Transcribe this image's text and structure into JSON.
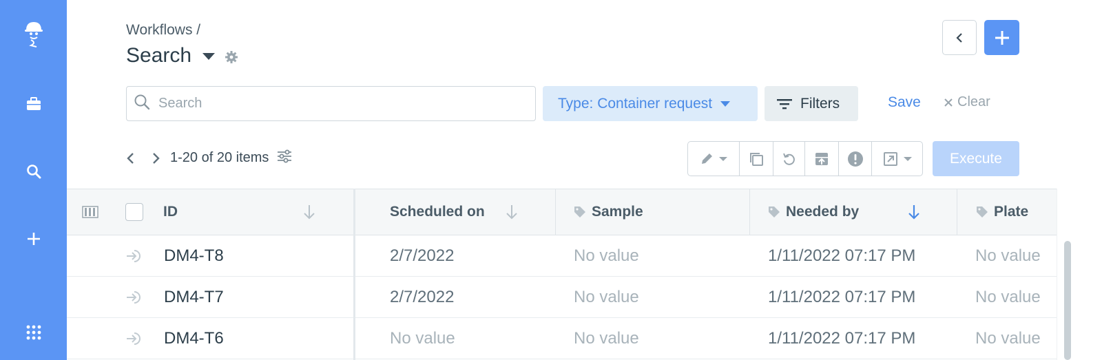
{
  "sidebar": {
    "items": [
      {
        "icon": "mascot-logo-icon"
      },
      {
        "icon": "briefcase-icon"
      },
      {
        "icon": "search-icon"
      },
      {
        "icon": "plus-icon"
      },
      {
        "icon": "apps-grid-icon"
      }
    ],
    "color": "#5b95f4"
  },
  "header": {
    "breadcrumb": "Workflows /",
    "title": "Search"
  },
  "search": {
    "placeholder": "Search",
    "value": ""
  },
  "toolbar": {
    "type_label": "Type: Container request",
    "filters_label": "Filters",
    "save_label": "Save",
    "clear_label": "Clear",
    "execute_label": "Execute"
  },
  "pagination": {
    "count_text": "1-20 of 20 items"
  },
  "table": {
    "columns": {
      "id": "ID",
      "scheduled_on": "Scheduled on",
      "sample": "Sample",
      "needed_by": "Needed by",
      "plate": "Plate"
    },
    "rows": [
      {
        "id": "DM4-T8",
        "scheduled_on": "2/7/2022",
        "sample": "No value",
        "needed_by": "1/11/2022 07:17 PM",
        "plate": "No value"
      },
      {
        "id": "DM4-T7",
        "scheduled_on": "2/7/2022",
        "sample": "No value",
        "needed_by": "1/11/2022 07:17 PM",
        "plate": "No value"
      },
      {
        "id": "DM4-T6",
        "scheduled_on": "No value",
        "sample": "No value",
        "needed_by": "1/11/2022 07:17 PM",
        "plate": "No value"
      }
    ]
  },
  "colors": {
    "accent": "#5b95f4",
    "link": "#4a8ae6",
    "type_bg": "#dcebfa",
    "execute_disabled": "#b9d4fb"
  }
}
